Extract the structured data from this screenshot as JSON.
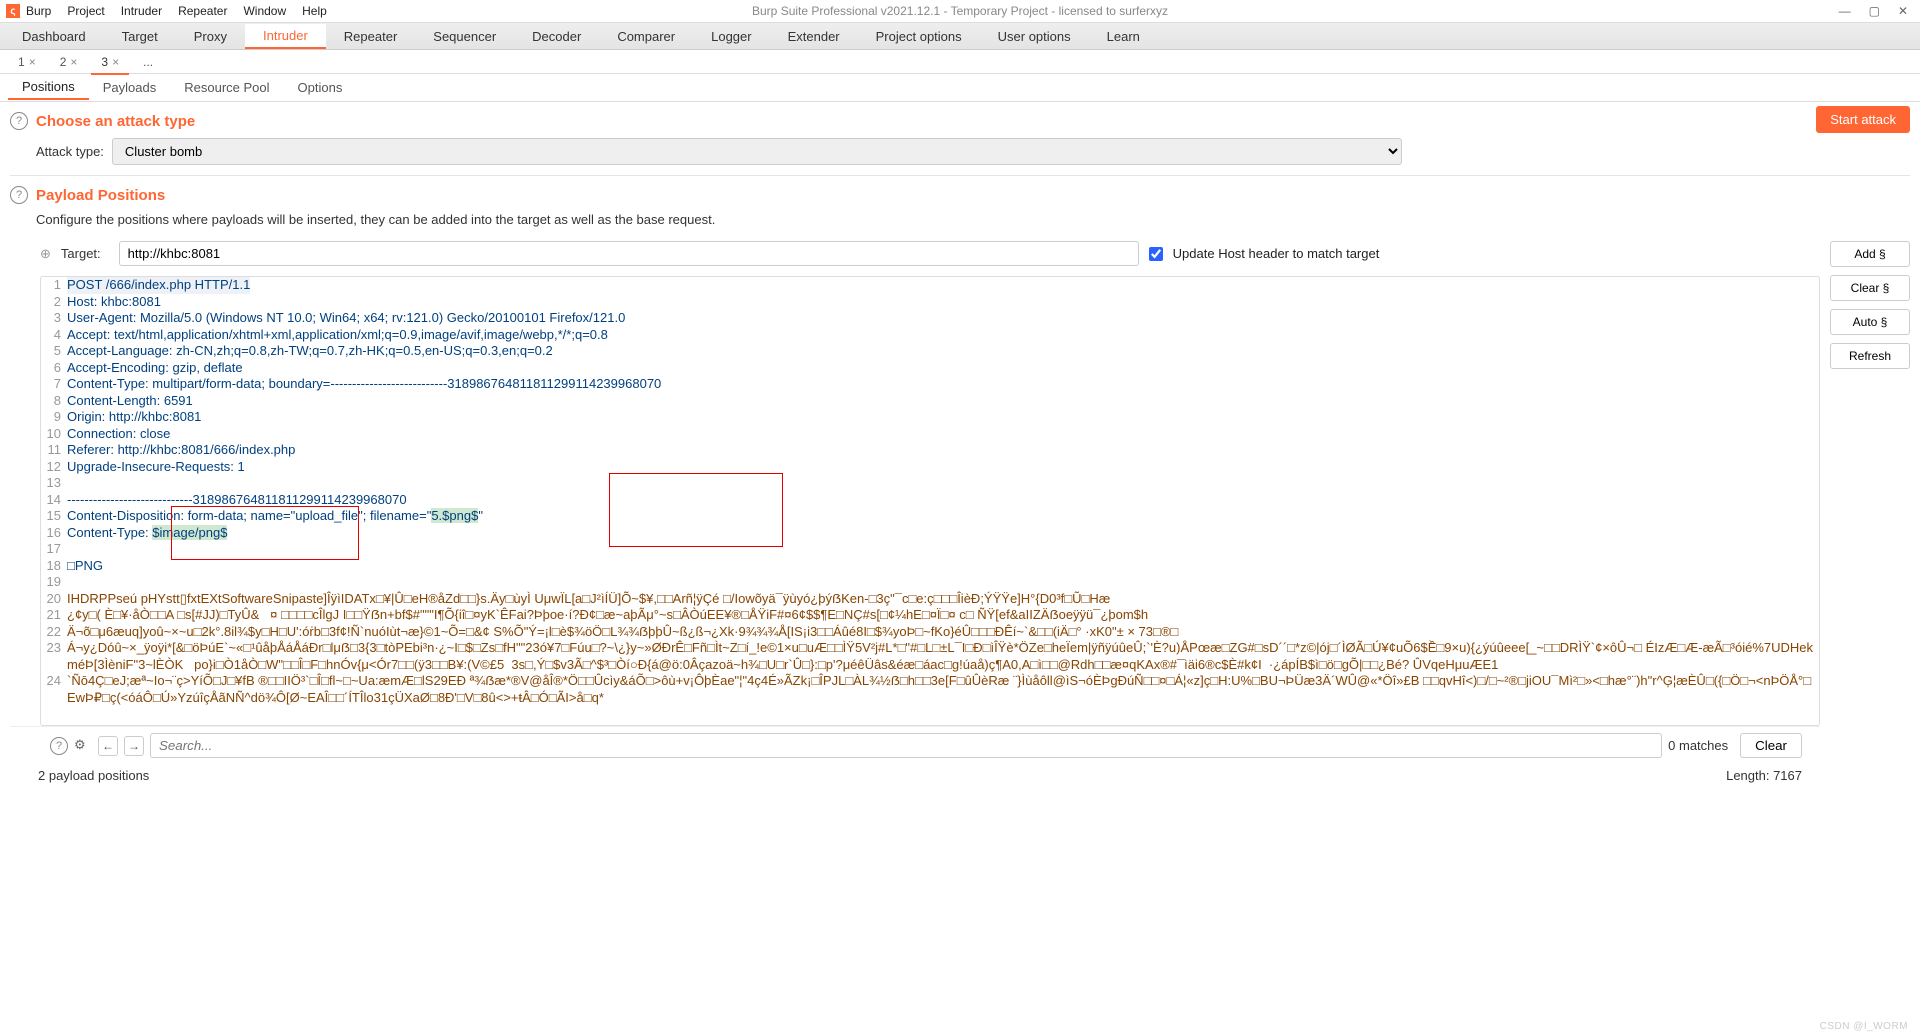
{
  "window": {
    "title": "Burp Suite Professional v2021.12.1 - Temporary Project - licensed to surferxyz",
    "logo_letter": "ς"
  },
  "menu": [
    "Burp",
    "Project",
    "Intruder",
    "Repeater",
    "Window",
    "Help"
  ],
  "main_tabs": [
    "Dashboard",
    "Target",
    "Proxy",
    "Intruder",
    "Repeater",
    "Sequencer",
    "Decoder",
    "Comparer",
    "Logger",
    "Extender",
    "Project options",
    "User options",
    "Learn"
  ],
  "main_active": "Intruder",
  "sub_tabs": [
    {
      "label": "1",
      "close": "×"
    },
    {
      "label": "2",
      "close": "×"
    },
    {
      "label": "3",
      "close": "×"
    },
    {
      "label": "...",
      "close": ""
    }
  ],
  "sub_active_index": 2,
  "section_tabs": [
    "Positions",
    "Payloads",
    "Resource Pool",
    "Options"
  ],
  "section_active": "Positions",
  "attack": {
    "header": "Choose an attack type",
    "start": "Start attack",
    "type_label": "Attack type:",
    "type_value": "Cluster bomb"
  },
  "payload": {
    "header": "Payload Positions",
    "description": "Configure the positions where payloads will be inserted, they can be added into the target as well as the base request.",
    "target_label": "Target:",
    "target_value": "http://khbc:8081",
    "update_host": "Update Host header to match target"
  },
  "request": {
    "lines": [
      {
        "n": "1",
        "cls": "first",
        "t": "POST /666/index.php HTTP/1.1"
      },
      {
        "n": "2",
        "t": "Host: khbc:8081"
      },
      {
        "n": "3",
        "t": "User-Agent: Mozilla/5.0 (Windows NT 10.0; Win64; x64; rv:121.0) Gecko/20100101 Firefox/121.0"
      },
      {
        "n": "4",
        "t": "Accept: text/html,application/xhtml+xml,application/xml;q=0.9,image/avif,image/webp,*/*;q=0.8"
      },
      {
        "n": "5",
        "t": "Accept-Language: zh-CN,zh;q=0.8,zh-TW;q=0.7,zh-HK;q=0.5,en-US;q=0.3,en;q=0.2"
      },
      {
        "n": "6",
        "t": "Accept-Encoding: gzip, deflate"
      },
      {
        "n": "7",
        "t": "Content-Type: multipart/form-data; boundary=---------------------------318986764811811299114239968070"
      },
      {
        "n": "8",
        "t": "Content-Length: 6591"
      },
      {
        "n": "9",
        "t": "Origin: http://khbc:8081"
      },
      {
        "n": "10",
        "t": "Connection: close"
      },
      {
        "n": "11",
        "t": "Referer: http://khbc:8081/666/index.php"
      },
      {
        "n": "12",
        "t": "Upgrade-Insecure-Requests: 1"
      },
      {
        "n": "13",
        "t": ""
      },
      {
        "n": "14",
        "t": "-----------------------------318986764811811299114239968070"
      }
    ],
    "line15": {
      "n": "15",
      "pre": "Content-Disposition: form-data; name=\"upload_file\"; filename=\"",
      "hl_pre": "5.",
      "hl": "$png$",
      "post": "\""
    },
    "line16": {
      "n": "16",
      "pre": "Content-Type: ",
      "hl": "$image/png$"
    },
    "line17": {
      "n": "17",
      "t": ""
    },
    "line18": {
      "n": "18",
      "t": "□PNG"
    },
    "line19": {
      "n": "19",
      "t": ""
    },
    "bin": [
      {
        "n": "20",
        "t": "IHDRPPseú pHYstt▯fxtEXtSoftwareSnipaste]ÎÿìIDATx□¥|Û□eH®åZd□□}s.Äy□ùyÌ UμwÏL[a□J²ìÍÜ]Õ~$¥,□□Arñ¦ÿÇé □/Iowõyä¯ÿùyó¿þýẞKen-□3ç\"¯c□e:ç□□□ÎièÐ;ÝŸŸe]H°{D0³f□Ũ□Hæ"
      },
      {
        "n": "21",
        "t": "¿¢y□( È□¥·åÒ□□A □s[#JJ)□TyÛ&   ¤ □□□□cÎlgJ I□□Ÿẞn+bf$#\"\"\"I¶Õ{iî□¤yK`ÊFai?Þþoe·í?Ð¢□æ~aþÃμ°~s□ÂÒúEE¥®□ÅŸiF#¤6¢$$¶E□NÇ#s[□¢¼hE□¤Ï□¤ c□ ÑŸ[ef&aIIZÄẞoeÿÿü¯¿þom$h"
      },
      {
        "n": "22",
        "t": "Ä¬õ□μ6æuq]yoû~×~u□2k°.8il¾$y□H□U':óṙb□3f¢!Ñ`nuóIùt¬æ}©1~Õ=□&¢ S%Õ\"Ý=¡l□è$¾öÖ□L¾¾ẞþþÛ~ß¿ß¬¿Xk·9¾¾¾Å[IS¡i3□□Áûé8I□$¾yoÞ□~fKo}éÛ□□□ÐÊí~`&□□(iÄ□° ·xK0\"± × 73□®□"
      },
      {
        "n": "23",
        "t": "Á¬y¿Dóû~×_ÿoÿi*[&□öÞúE`~«□¹ûåþÅáÅáÐr□lμẞ□3{3□tòPEbi³n·¿~I□$□Zs□fH\"\"23ó¥7□Fúu□?~\\¿}y~»ØÐrÊ□Fñ□Ìt~Z□í_!e©1×u□uÆ□□ÌŸ5V²j#L*□\"#□L□±L¯I□Đ□ìÎŸè*ÖZe□heÏem|ÿñÿúûeÛ;`'È?u)ÅPœæ□ZG#□sD´´□*z©|ój□´ÌØÃ□Ú¥¢uÕ6$Ề□9×u){¿ýúûeee[_~□□DRÌŸ`¢×ôÛ¬□ ÉIzÆ□Æ-æÃ□³óié%7UDHekméÞ[3ÌèniF\"3~lÈÒK   po}i□Ò1åÒ□W\"□□Î□F□hnÓv{μ<Ór7□□(ÿ3□□B¥:(V©£5  3s□,Ý□$v3Ã□^$³□Òí○Đ{á@ö:0Âçazoä~h¾□U□r`Û□}:□p'?μéêÜâs&éæ□áac□g!úaå)ç¶A0,A□ì□□@Rdh□□æ¤qKAx®#¯ìäi6®c$È#k¢I  ·¿ápÍB$ì□ö□gÕ|□□¿Bé? ÛVqeHμuÆE1"
      },
      {
        "n": "24",
        "t": "`Ñō4Ç□eJ;æª~Io¬¨ç>YíÕ□J□¥fB ®□□IIÖ³`□Î□fl~□~Ua:æmÆ□lS29EÐ ª¾ẞæ*®V@åÎ®*Ö□□Ûcìy&áÕ□>ôù+v¡ÔþÈae\"¦\"4ç4É»ÃZk¡□ÎPJL□ÀL¾½ẞ□h□□3e[F□ûÛèRæ ¨}Ìùåôll@ìS¬óÈÞgÐúÑ□□¤□Á¦«z]ç□H:U%□BU¬ÞÜæ3Ä´WÛ@«*Öî»£B □□qvHî<)□/□~²®□jiOU¯Mì²□»<□hæ°¨)h\"r^Ģ¦æÈÛ□({□Ö□¬<nÞÖÅ°□EwÞ₽□ç(<óáÔ□Ú»YzúîçÅãNÑ^dö¾Ô[Ø~EAÎ□□´ÍTÎlo31çÜXaØ□8Đ'□V□8û<>+ŧÂ□Ó□ÃI>å□q*"
      }
    ]
  },
  "side_buttons": [
    "Add §",
    "Clear §",
    "Auto §",
    "Refresh"
  ],
  "search": {
    "placeholder": "Search...",
    "matches": "0 matches",
    "clear": "Clear"
  },
  "status": {
    "positions": "2 payload positions",
    "length": "Length: 7167"
  },
  "watermark": "CSDN @I_WORM"
}
